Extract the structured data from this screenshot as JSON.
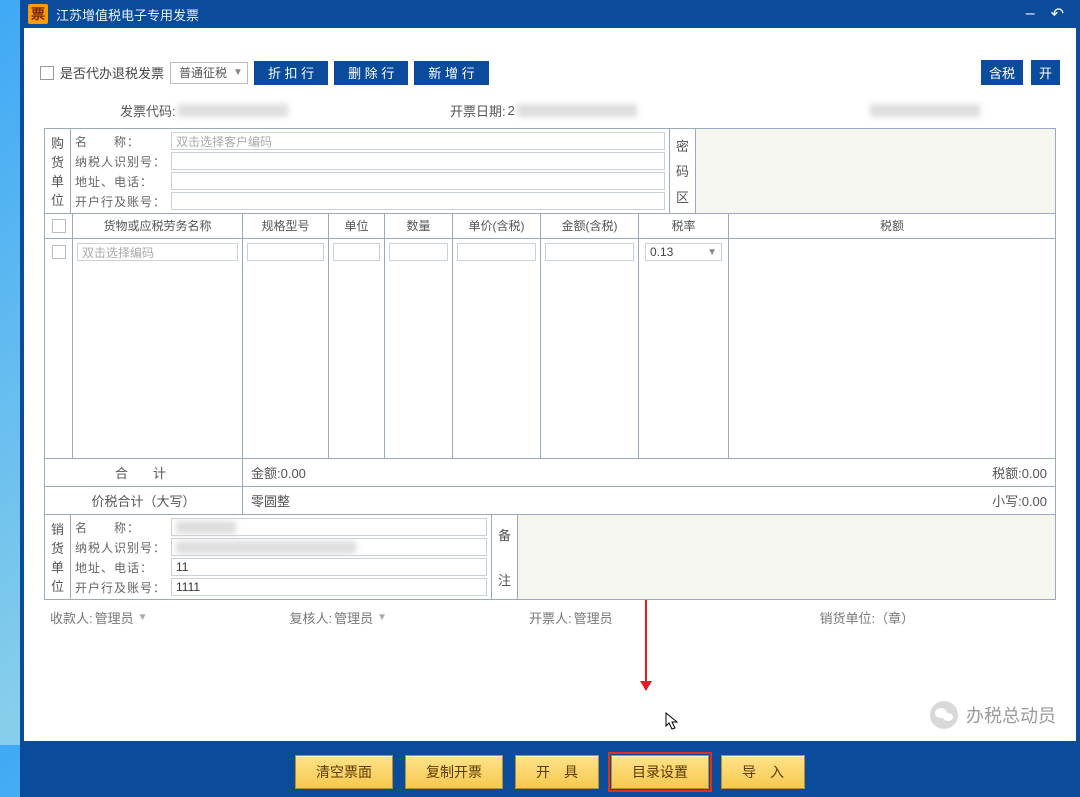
{
  "window": {
    "logo_char": "票",
    "title": "江苏增值税电子专用发票",
    "minimize": "–",
    "back": "↶"
  },
  "toolbar": {
    "refund_checkbox_label": "是否代办退税发票",
    "tax_type_selected": "普通征税",
    "btn_discount": "折 扣 行",
    "btn_delete": "删 除 行",
    "btn_add": "新 增 行",
    "tag_contain": "含税",
    "tag_open": "开"
  },
  "header": {
    "code_label": "发票代码:",
    "date_label": "开票日期:",
    "date_prefix": "2"
  },
  "buyer": {
    "section_chars": [
      "购",
      "货",
      "单",
      "位"
    ],
    "name_label": "名　　称：",
    "name_placeholder": "双击选择客户编码",
    "taxid_label": "纳税人识别号：",
    "addr_label": "地址、电话：",
    "bank_label": "开户行及账号："
  },
  "pwd_section_chars": [
    "密",
    "码",
    "区"
  ],
  "goods": {
    "head": {
      "name": "货物或应税劳务名称",
      "spec": "规格型号",
      "unit": "单位",
      "qty": "数量",
      "price": "单价(含税)",
      "amount": "金额(含税)",
      "rate": "税率",
      "tax": "税额"
    },
    "row_name_placeholder": "双击选择编码",
    "row_rate_value": "0.13"
  },
  "sum": {
    "label": "合　计",
    "amount_text": "金额:0.00",
    "tax_text": "税额:0.00"
  },
  "total": {
    "label": "价税合计（大写）",
    "upper_text": "零圆整",
    "lower_text": "小写:0.00"
  },
  "seller": {
    "section_chars": [
      "销",
      "货",
      "单",
      "位"
    ],
    "name_label": "名　　称：",
    "taxid_label": "纳税人识别号：",
    "addr_label": "地址、电话：",
    "addr_value": "11",
    "bank_label": "开户行及账号：",
    "bank_value": "1111"
  },
  "remark_section_chars": [
    "备",
    " ",
    "注"
  ],
  "footer": {
    "payee_label": "收款人:",
    "payee_value": "管理员",
    "reviewer_label": "复核人:",
    "reviewer_value": "管理员",
    "issuer_label": "开票人:",
    "issuer_value": "管理员",
    "seller_unit_label": "销货单位:（章）"
  },
  "bottom_buttons": {
    "clear": "清空票面",
    "copy": "复制开票",
    "issue": "开　具",
    "catalog": "目录设置",
    "import": "导　入"
  },
  "watermark": "办税总动员"
}
